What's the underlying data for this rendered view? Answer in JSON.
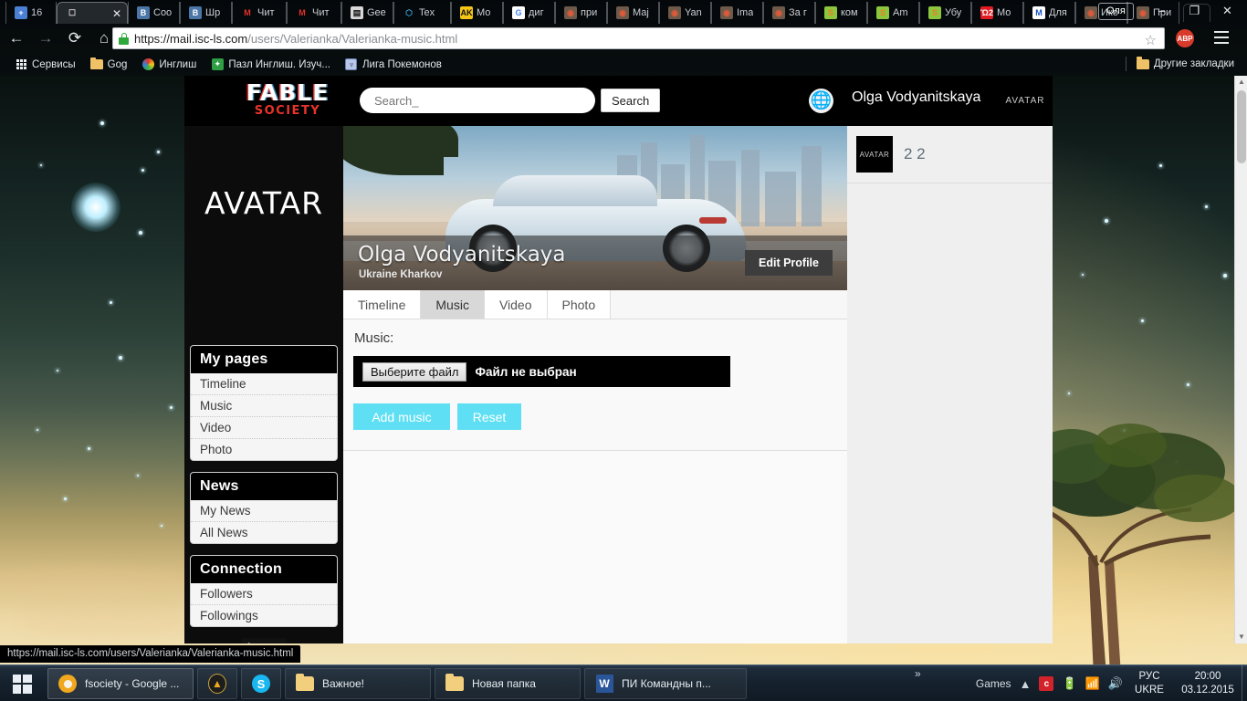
{
  "browser": {
    "tabs": [
      {
        "label": "16",
        "icon": "plus-icon",
        "icon_bg": "#4a7fd4",
        "icon_fg": "#ffffff",
        "glyph": "+",
        "active": false
      },
      {
        "label": "",
        "icon": "page-icon",
        "icon_bg": "transparent",
        "icon_fg": "#dddddd",
        "glyph": "☐",
        "active": true
      },
      {
        "label": "Соо",
        "icon": "vk-icon",
        "icon_bg": "#4a76a8",
        "icon_fg": "#ffffff",
        "glyph": "B",
        "active": false
      },
      {
        "label": "Шр",
        "icon": "vk-icon",
        "icon_bg": "#4a76a8",
        "icon_fg": "#ffffff",
        "glyph": "B",
        "active": false
      },
      {
        "label": "Чит",
        "icon": "m-icon",
        "icon_bg": "transparent",
        "icon_fg": "#e4322b",
        "glyph": "M",
        "active": false
      },
      {
        "label": "Чит",
        "icon": "m-icon",
        "icon_bg": "transparent",
        "icon_fg": "#e4322b",
        "glyph": "M",
        "active": false
      },
      {
        "label": "Gee",
        "icon": "geek-icon",
        "icon_bg": "#d8d8d8",
        "icon_fg": "#111111",
        "glyph": "▤",
        "active": false
      },
      {
        "label": "Tex",
        "icon": "cube-icon",
        "icon_bg": "transparent",
        "icon_fg": "#3aa7e0",
        "glyph": "⬡",
        "active": false
      },
      {
        "label": "Мо",
        "icon": "ak-icon",
        "icon_bg": "#f5c518",
        "icon_fg": "#111111",
        "glyph": "AK",
        "active": false
      },
      {
        "label": "диг",
        "icon": "google-icon",
        "icon_bg": "#ffffff",
        "icon_fg": "#4285f4",
        "glyph": "G",
        "active": false
      },
      {
        "label": "при",
        "icon": "photo-icon",
        "icon_bg": "#6d5a4a",
        "icon_fg": "#e05a3a",
        "glyph": "◉",
        "active": false
      },
      {
        "label": "Маj",
        "icon": "photo-icon",
        "icon_bg": "#6d5a4a",
        "icon_fg": "#e05a3a",
        "glyph": "◉",
        "active": false
      },
      {
        "label": "Yan",
        "icon": "photo-icon",
        "icon_bg": "#6d5a4a",
        "icon_fg": "#e05a3a",
        "glyph": "◉",
        "active": false
      },
      {
        "label": "Ima",
        "icon": "photo-icon",
        "icon_bg": "#6d5a4a",
        "icon_fg": "#e05a3a",
        "glyph": "◉",
        "active": false
      },
      {
        "label": "За г",
        "icon": "photo-icon",
        "icon_bg": "#6d5a4a",
        "icon_fg": "#e05a3a",
        "glyph": "◉",
        "active": false
      },
      {
        "label": "ком",
        "icon": "green-s-icon",
        "icon_bg": "#8bc63e",
        "icon_fg": "#ef7b28",
        "glyph": "S",
        "active": false
      },
      {
        "label": "Am",
        "icon": "green-s-icon",
        "icon_bg": "#8bc63e",
        "icon_fg": "#ef7b28",
        "glyph": "S",
        "active": false
      },
      {
        "label": "Убу",
        "icon": "green-s-icon",
        "icon_bg": "#8bc63e",
        "icon_fg": "#ef7b28",
        "glyph": "S",
        "active": false
      },
      {
        "label": "Мо",
        "icon": "cart-icon",
        "icon_bg": "#e11b22",
        "icon_fg": "#ffffff",
        "glyph": "Ὥ2",
        "active": false
      },
      {
        "label": "Для",
        "icon": "webm-icon",
        "icon_bg": "#ffffff",
        "icon_fg": "#1a53c4",
        "glyph": "M",
        "active": false
      },
      {
        "label": "Ико",
        "icon": "photo-icon",
        "icon_bg": "#6d5a4a",
        "icon_fg": "#e05a3a",
        "glyph": "◉",
        "active": false
      },
      {
        "label": "При",
        "icon": "photo-icon",
        "icon_bg": "#6d5a4a",
        "icon_fg": "#e05a3a",
        "glyph": "◉",
        "active": false
      }
    ],
    "profile_name": "Оля",
    "window_minimize": "–",
    "window_restore": "❐",
    "window_close": "✕",
    "nav": {
      "back": "←",
      "forward": "→",
      "reload": "⟳",
      "home": "⌂",
      "bookmark_star": "☆",
      "adblock": "ABP"
    },
    "url_host": "https://mail.isc-ls.com",
    "url_path": "/users/Valerianka/Valerianka-music.html",
    "bookmarks": [
      {
        "label": "Сервисы",
        "icon": "apps-grid-icon"
      },
      {
        "label": "Gog",
        "icon": "folder-icon"
      },
      {
        "label": "Инглиш",
        "icon": "colors-icon"
      },
      {
        "label": "Пазл Инглиш. Изуч...",
        "icon": "puzzle-icon"
      },
      {
        "label": "Лига Покемонов",
        "icon": "pokeball-icon"
      }
    ],
    "other_bookmarks": "Другие закладки",
    "status_bar_url": "https://mail.isc-ls.com/users/Valerianka/Valerianka-music.html"
  },
  "site": {
    "logo_main": "FABLE",
    "logo_sub": "SOCIETY",
    "search_placeholder": "Search_",
    "search_value": "",
    "search_button": "Search",
    "globe_icon": "🌐",
    "user_name": "Olga Vodyanitskaya",
    "user_avatar_label": "AVATAR",
    "big_avatar_label": "AVATAR",
    "cover": {
      "name": "Olga Vodyanitskaya",
      "location": "Ukraine Kharkov",
      "edit_button": "Edit Profile"
    },
    "tabs": [
      {
        "label": "Timeline",
        "active": false
      },
      {
        "label": "Music",
        "active": true
      },
      {
        "label": "Video",
        "active": false
      },
      {
        "label": "Photo",
        "active": false
      }
    ],
    "music_panel": {
      "heading": "Music:",
      "file_button": "Выберите файл",
      "file_status": "Файл не выбран",
      "add_button": "Add music",
      "reset_button": "Reset",
      "accent_color": "#5fdff4"
    },
    "sidebar": [
      {
        "title": "My pages",
        "items": [
          "Timeline",
          "Music",
          "Video",
          "Photo"
        ]
      },
      {
        "title": "News",
        "items": [
          "My News",
          "All News"
        ]
      },
      {
        "title": "Connection",
        "items": [
          "Followers",
          "Followings"
        ]
      }
    ],
    "logout_button": "logout",
    "feed": {
      "avatar_label": "AVATAR",
      "text": "2 2"
    }
  },
  "taskbar": {
    "start_label": "Start",
    "items": [
      {
        "label": "fsociety - Google ...",
        "icon": "chrome-icon",
        "active": true
      },
      {
        "label": "",
        "icon": "aimp-icon",
        "active": false
      },
      {
        "label": "",
        "icon": "skype-icon",
        "active": false
      },
      {
        "label": "Важное!",
        "icon": "folder-icon",
        "active": false
      },
      {
        "label": "Новая папка",
        "icon": "folder-icon",
        "active": false
      },
      {
        "label": "ПИ Командны п...",
        "icon": "word-icon",
        "active": false
      }
    ],
    "games_label": "Games",
    "overflow_glyph": "»",
    "tray_expand": "▲",
    "tray_icons": [
      "comodo-icon",
      "battery-icon",
      "network-icon",
      "volume-icon"
    ],
    "language_line1": "РУС",
    "language_line2": "UKRE",
    "time": "20:00",
    "date": "03.12.2015"
  }
}
